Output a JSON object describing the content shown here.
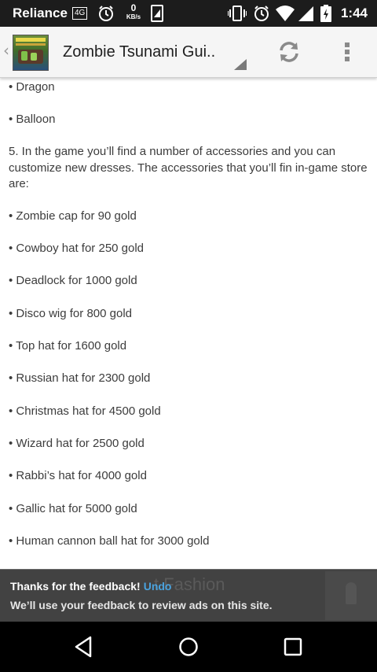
{
  "status_bar": {
    "carrier": "Reliance",
    "network_badge": "4G",
    "data_speed_value": "0",
    "data_speed_unit": "KB/s",
    "time": "1:44",
    "icons": [
      "alarm-icon",
      "notification-icon",
      "vibrate-icon",
      "alarm-icon",
      "wifi-icon",
      "signal-icon",
      "battery-icon"
    ]
  },
  "app_bar": {
    "title": "Zombie Tsunami Gui..",
    "refresh_icon": "refresh-icon",
    "overflow_icon": "more-vert-icon"
  },
  "article": {
    "bullets_top": [
      "• Dragon",
      "• Balloon"
    ],
    "paragraph": "5. In the game you’ll find a number of accessories and you can customize new dresses. The accessories that you’ll fin in-game store are:",
    "accessories": [
      "• Zombie cap for 90 gold",
      "• Cowboy hat for 250 gold",
      "• Deadlock for 1000 gold",
      "• Disco wig for 800 gold",
      "• Top hat for 1600 gold",
      "• Russian hat for 2300 gold",
      "• Christmas hat for 4500 gold",
      "• Wizard hat for 2500 gold",
      "• Rabbi’s hat for 4000 gold",
      "• Gallic hat for 5000 gold",
      "• Human cannon ball hat for 3000 gold"
    ]
  },
  "snackbar": {
    "message": "Thanks for the feedback!",
    "action": "Undo",
    "detail": "We’ll use your feedback to review ads on this site.",
    "background_text": "t Fashion"
  },
  "nav_bar": {
    "buttons": [
      "back-icon",
      "home-icon",
      "recents-icon"
    ]
  },
  "colors": {
    "status_bar": "#1c1c1c",
    "action_bar": "#f5f5f5",
    "snackbar": "#424242",
    "undo_accent": "#4aa3df",
    "nav_bar": "#000000",
    "body_text": "#3c3c3c"
  }
}
